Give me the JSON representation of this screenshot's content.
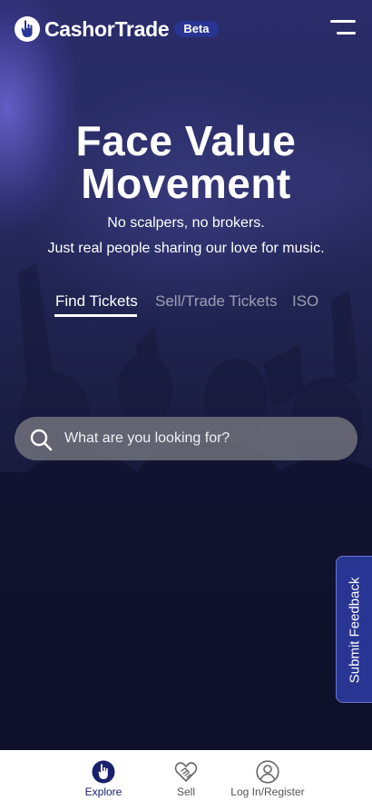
{
  "header": {
    "brand": "CashorTrade",
    "badge": "Beta"
  },
  "hero": {
    "headline_line1": "Face Value",
    "headline_line2": "Movement",
    "subline1": "No scalpers, no brokers.",
    "subline2": "Just real people sharing our love for music."
  },
  "tabs": [
    {
      "label": "Find Tickets",
      "active": true
    },
    {
      "label": "Sell/Trade Tickets",
      "active": false
    },
    {
      "label": "ISO",
      "active": false
    }
  ],
  "search": {
    "placeholder": "What are you looking for?",
    "value": ""
  },
  "feedback": {
    "label": "Submit Feedback"
  },
  "bottom_nav": [
    {
      "label": "Explore",
      "icon": "explore-icon",
      "active": true
    },
    {
      "label": "Sell",
      "icon": "handshake-icon",
      "active": false
    },
    {
      "label": "Log In/Register",
      "icon": "user-icon",
      "active": false
    }
  ],
  "colors": {
    "brand_navy": "#283593",
    "active_nav": "#1a1f6e",
    "inactive_nav": "#555555"
  }
}
